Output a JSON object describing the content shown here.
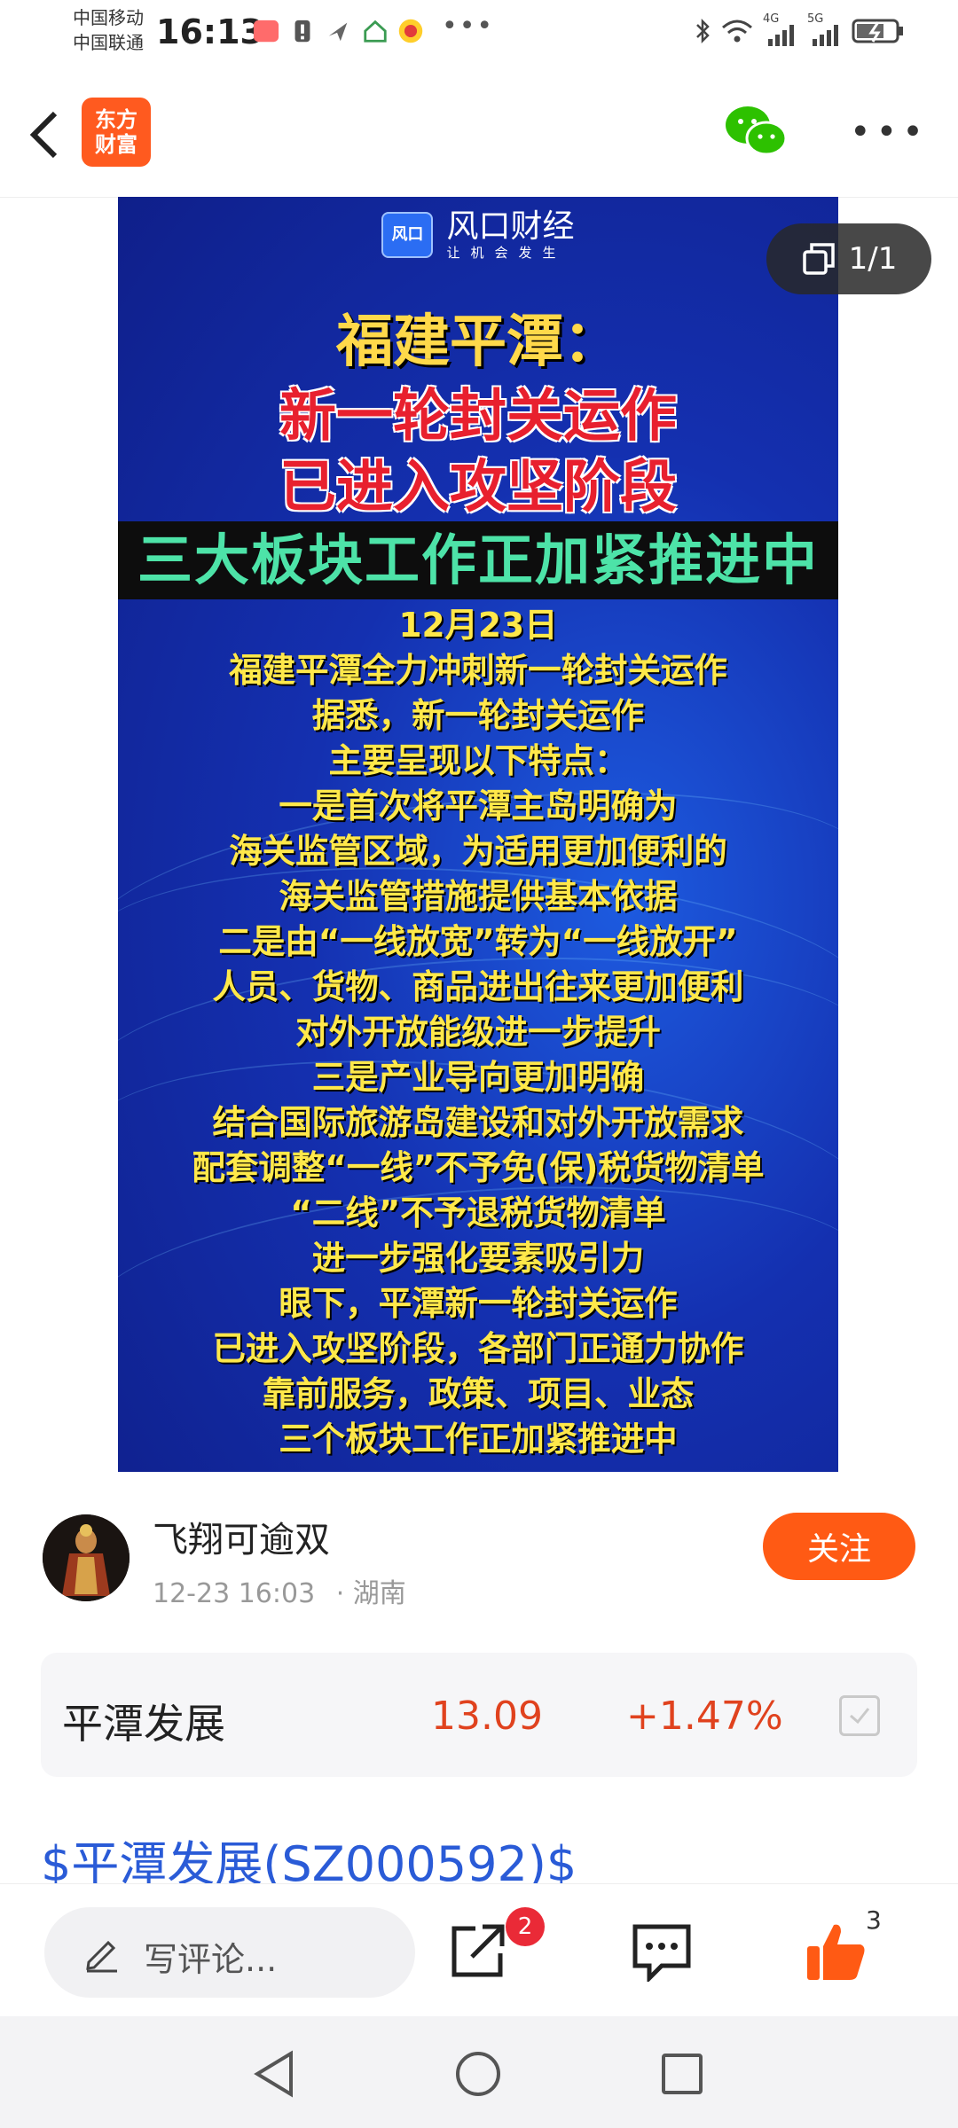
{
  "status_bar": {
    "carrier1": "中国移动",
    "carrier2": "中国联通",
    "time": "16:13",
    "network1": "4G",
    "network2": "5G"
  },
  "header": {
    "logo_line1": "东方",
    "logo_line2": "财富"
  },
  "poster": {
    "brand_name": "风口财经",
    "brand_slogan": "让机会发生",
    "brand_mark": "风口",
    "title_line1": "福建平潭：",
    "title_line2": "新一轮封关运作",
    "title_line3": "已进入攻坚阶段",
    "banner": "三大板块工作正加紧推进中",
    "body_lines": [
      "12月23日",
      "福建平潭全力冲刺新一轮封关运作",
      "据悉，新一轮封关运作",
      "主要呈现以下特点：",
      "一是首次将平潭主岛明确为",
      "海关监管区域，为适用更加便利的",
      "海关监管措施提供基本依据",
      "二是由“一线放宽”转为“一线放开”",
      "人员、货物、商品进出往来更加便利",
      "对外开放能级进一步提升",
      "三是产业导向更加明确",
      "结合国际旅游岛建设和对外开放需求",
      "配套调整“一线”不予免(保)税货物清单",
      "“二线”不予退税货物清单",
      "进一步强化要素吸引力",
      "眼下，平潭新一轮封关运作",
      "已进入攻坚阶段，各部门正通力协作",
      "靠前服务，政策、项目、业态",
      "三个板块工作正加紧推进中"
    ]
  },
  "image_counter": "1/1",
  "author": {
    "name": "飞翔可逾双",
    "timestamp": "12-23 16:03",
    "location": "· 湖南",
    "follow_label": "关注"
  },
  "stock_card": {
    "name": "平潭发展",
    "price": "13.09",
    "change": "+1.47%"
  },
  "stock_link": "$平潭发展(SZ000592)$",
  "bottom_bar": {
    "comment_placeholder": "写评论...",
    "share_badge": "2",
    "like_count": "3"
  },
  "colors": {
    "accent": "#ff5a14",
    "up": "#e0421e",
    "link": "#2a5bd7"
  }
}
